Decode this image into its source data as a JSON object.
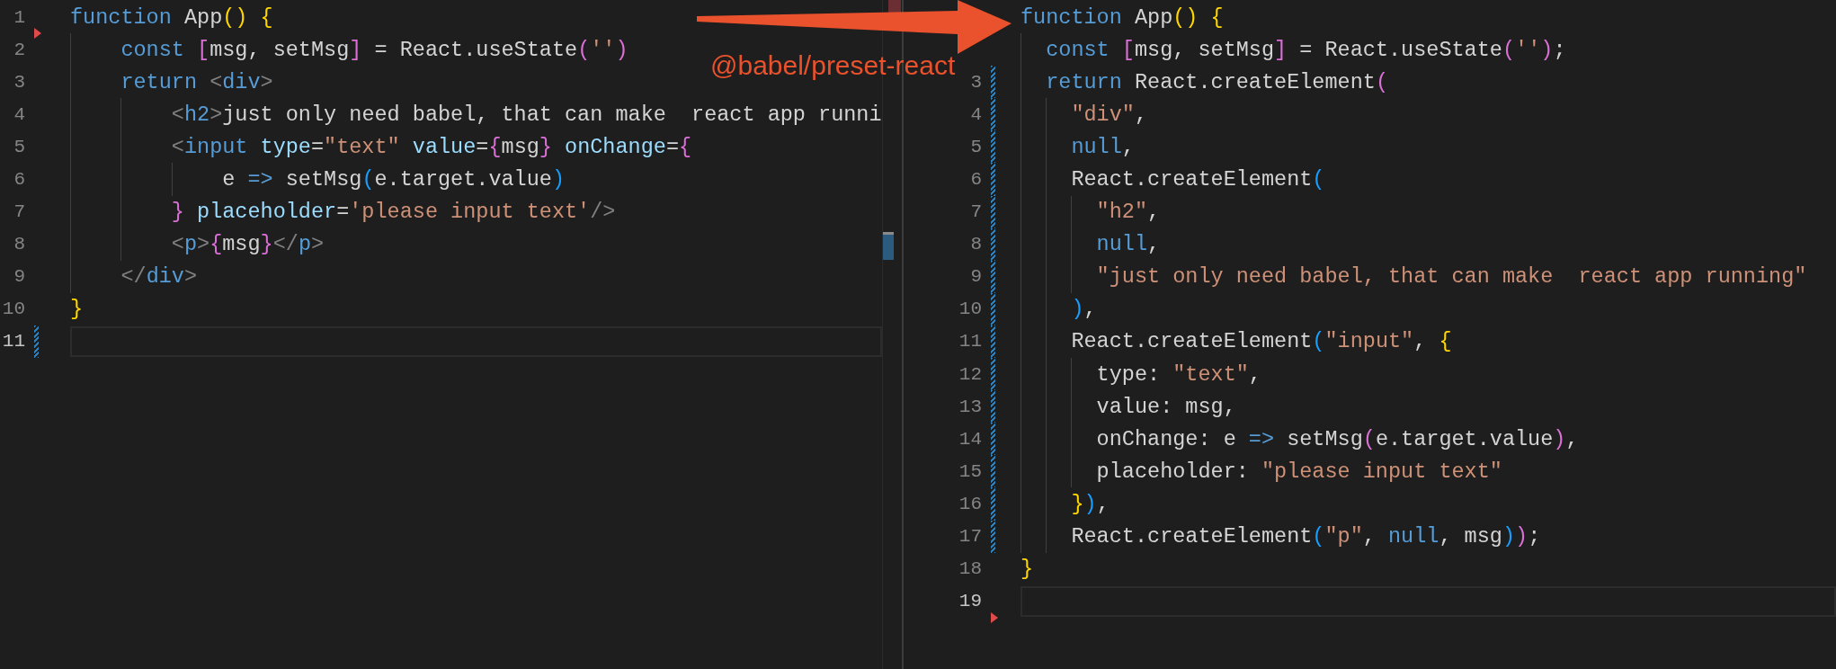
{
  "panes": [
    {
      "lines": [
        {
          "number": "1",
          "current": false,
          "added": false,
          "deleted": true,
          "tokens": [
            {
              "kind": "kw",
              "text": "function"
            },
            {
              "kind": "pl",
              "text": " App"
            },
            {
              "kind": "b1",
              "text": "()"
            },
            {
              "kind": "b1",
              "text": " {"
            }
          ]
        },
        {
          "number": "2",
          "current": false,
          "added": false,
          "deleted": false,
          "tokens": [
            {
              "kind": "kw",
              "text": "    const"
            },
            {
              "kind": "b2",
              "text": " ["
            },
            {
              "kind": "pl",
              "text": "msg, setMsg"
            },
            {
              "kind": "b2",
              "text": "]"
            },
            {
              "kind": "pl",
              "text": " = React.useState"
            },
            {
              "kind": "b2",
              "text": "("
            },
            {
              "kind": "str",
              "text": "''"
            },
            {
              "kind": "b2",
              "text": ")"
            }
          ]
        },
        {
          "number": "3",
          "current": false,
          "added": false,
          "deleted": false,
          "tokens": [
            {
              "kind": "kw",
              "text": "    return"
            },
            {
              "kind": "pu",
              "text": " <"
            },
            {
              "kind": "tag",
              "text": "div"
            },
            {
              "kind": "pu",
              "text": ">"
            }
          ]
        },
        {
          "number": "4",
          "current": false,
          "added": false,
          "deleted": false,
          "tokens": [
            {
              "kind": "pu",
              "text": "        <"
            },
            {
              "kind": "tag",
              "text": "h2"
            },
            {
              "kind": "pu",
              "text": ">"
            },
            {
              "kind": "pl",
              "text": "just only need babel, that can make  react app runni"
            }
          ]
        },
        {
          "number": "5",
          "current": false,
          "added": false,
          "deleted": false,
          "tokens": [
            {
              "kind": "pu",
              "text": "        <"
            },
            {
              "kind": "tag",
              "text": "input"
            },
            {
              "kind": "attr",
              "text": " type"
            },
            {
              "kind": "pl",
              "text": "="
            },
            {
              "kind": "str",
              "text": "\"text\""
            },
            {
              "kind": "attr",
              "text": " value"
            },
            {
              "kind": "pl",
              "text": "="
            },
            {
              "kind": "b2",
              "text": "{"
            },
            {
              "kind": "pl",
              "text": "msg"
            },
            {
              "kind": "b2",
              "text": "}"
            },
            {
              "kind": "attr",
              "text": " onChange"
            },
            {
              "kind": "pl",
              "text": "="
            },
            {
              "kind": "b2",
              "text": "{"
            }
          ]
        },
        {
          "number": "6",
          "current": false,
          "added": false,
          "deleted": false,
          "tokens": [
            {
              "kind": "pl",
              "text": "            e "
            },
            {
              "kind": "kw",
              "text": "=>"
            },
            {
              "kind": "pl",
              "text": " setMsg"
            },
            {
              "kind": "b3",
              "text": "("
            },
            {
              "kind": "pl",
              "text": "e.target.value"
            },
            {
              "kind": "b3",
              "text": ")"
            }
          ]
        },
        {
          "number": "7",
          "current": false,
          "added": false,
          "deleted": false,
          "tokens": [
            {
              "kind": "b2",
              "text": "        }"
            },
            {
              "kind": "attr",
              "text": " placeholder"
            },
            {
              "kind": "pl",
              "text": "="
            },
            {
              "kind": "str",
              "text": "'please input text'"
            },
            {
              "kind": "pu",
              "text": "/>"
            }
          ]
        },
        {
          "number": "8",
          "current": false,
          "added": false,
          "deleted": false,
          "tokens": [
            {
              "kind": "pu",
              "text": "        <"
            },
            {
              "kind": "tag",
              "text": "p"
            },
            {
              "kind": "pu",
              "text": ">"
            },
            {
              "kind": "b2",
              "text": "{"
            },
            {
              "kind": "pl",
              "text": "msg"
            },
            {
              "kind": "b2",
              "text": "}"
            },
            {
              "kind": "pu",
              "text": "</"
            },
            {
              "kind": "tag",
              "text": "p"
            },
            {
              "kind": "pu",
              "text": ">"
            }
          ]
        },
        {
          "number": "9",
          "current": false,
          "added": false,
          "deleted": false,
          "tokens": [
            {
              "kind": "pu",
              "text": "    </"
            },
            {
              "kind": "tag",
              "text": "div"
            },
            {
              "kind": "pu",
              "text": ">"
            }
          ]
        },
        {
          "number": "10",
          "current": false,
          "added": false,
          "deleted": false,
          "tokens": [
            {
              "kind": "b1",
              "text": "}"
            }
          ]
        },
        {
          "number": "11",
          "current": true,
          "added": true,
          "deleted": false
        }
      ]
    },
    {
      "lines": [
        {
          "current": false,
          "added": false,
          "deleted": false,
          "tokens": [
            {
              "kind": "kw",
              "text": "function"
            },
            {
              "kind": "pl",
              "text": " App"
            },
            {
              "kind": "b1",
              "text": "()"
            },
            {
              "kind": "b1",
              "text": " {"
            }
          ]
        },
        {
          "current": false,
          "added": false,
          "deleted": false,
          "tokens": [
            {
              "kind": "kw",
              "text": "  const"
            },
            {
              "kind": "b2",
              "text": " ["
            },
            {
              "kind": "pl",
              "text": "msg, setMsg"
            },
            {
              "kind": "b2",
              "text": "]"
            },
            {
              "kind": "pl",
              "text": " = React.useState"
            },
            {
              "kind": "b2",
              "text": "("
            },
            {
              "kind": "str",
              "text": "''"
            },
            {
              "kind": "b2",
              "text": ")"
            },
            {
              "kind": "pl",
              "text": ";"
            }
          ]
        },
        {
          "number": "3",
          "current": false,
          "added": true,
          "deleted": false,
          "tokens": [
            {
              "kind": "kw",
              "text": "  return"
            },
            {
              "kind": "pl",
              "text": " React.createElement"
            },
            {
              "kind": "b2",
              "text": "("
            }
          ]
        },
        {
          "number": "4",
          "current": false,
          "added": true,
          "deleted": false,
          "tokens": [
            {
              "kind": "str",
              "text": "    \"div\""
            },
            {
              "kind": "pl",
              "text": ","
            }
          ]
        },
        {
          "number": "5",
          "current": false,
          "added": true,
          "deleted": false,
          "tokens": [
            {
              "kind": "kw",
              "text": "    null"
            },
            {
              "kind": "pl",
              "text": ","
            }
          ]
        },
        {
          "number": "6",
          "current": false,
          "added": true,
          "deleted": false,
          "tokens": [
            {
              "kind": "pl",
              "text": "    React.createElement"
            },
            {
              "kind": "b3",
              "text": "("
            }
          ]
        },
        {
          "number": "7",
          "current": false,
          "added": true,
          "deleted": false,
          "tokens": [
            {
              "kind": "str",
              "text": "      \"h2\""
            },
            {
              "kind": "pl",
              "text": ","
            }
          ]
        },
        {
          "number": "8",
          "current": false,
          "added": true,
          "deleted": false,
          "tokens": [
            {
              "kind": "kw",
              "text": "      null"
            },
            {
              "kind": "pl",
              "text": ","
            }
          ]
        },
        {
          "number": "9",
          "current": false,
          "added": true,
          "deleted": false,
          "tokens": [
            {
              "kind": "str",
              "text": "      \"just only need babel, that can make  react app running\""
            }
          ]
        },
        {
          "number": "10",
          "current": false,
          "added": true,
          "deleted": false,
          "tokens": [
            {
              "kind": "b3",
              "text": "    )"
            },
            {
              "kind": "pl",
              "text": ","
            }
          ]
        },
        {
          "number": "11",
          "current": false,
          "added": true,
          "deleted": false,
          "tokens": [
            {
              "kind": "pl",
              "text": "    React.createElement"
            },
            {
              "kind": "b3",
              "text": "("
            },
            {
              "kind": "str",
              "text": "\"input\""
            },
            {
              "kind": "pl",
              "text": ","
            },
            {
              "kind": "b1",
              "text": " {"
            }
          ]
        },
        {
          "number": "12",
          "current": false,
          "added": true,
          "deleted": false,
          "tokens": [
            {
              "kind": "pl",
              "text": "      type:"
            },
            {
              "kind": "str",
              "text": " \"text\""
            },
            {
              "kind": "pl",
              "text": ","
            }
          ]
        },
        {
          "number": "13",
          "current": false,
          "added": true,
          "deleted": false,
          "tokens": [
            {
              "kind": "pl",
              "text": "      value: msg,"
            }
          ]
        },
        {
          "number": "14",
          "current": false,
          "added": true,
          "deleted": false,
          "tokens": [
            {
              "kind": "pl",
              "text": "      onChange: e"
            },
            {
              "kind": "kw",
              "text": " =>"
            },
            {
              "kind": "pl",
              "text": " setMsg"
            },
            {
              "kind": "b2",
              "text": "("
            },
            {
              "kind": "pl",
              "text": "e.target.value"
            },
            {
              "kind": "b2",
              "text": ")"
            },
            {
              "kind": "pl",
              "text": ","
            }
          ]
        },
        {
          "number": "15",
          "current": false,
          "added": true,
          "deleted": false,
          "tokens": [
            {
              "kind": "pl",
              "text": "      placeholder:"
            },
            {
              "kind": "str",
              "text": " \"please input text\""
            }
          ]
        },
        {
          "number": "16",
          "current": false,
          "added": true,
          "deleted": false,
          "tokens": [
            {
              "kind": "b1",
              "text": "    }"
            },
            {
              "kind": "b3",
              "text": ")"
            },
            {
              "kind": "pl",
              "text": ","
            }
          ]
        },
        {
          "number": "17",
          "current": false,
          "added": true,
          "deleted": false,
          "tokens": [
            {
              "kind": "pl",
              "text": "    React.createElement"
            },
            {
              "kind": "b3",
              "text": "("
            },
            {
              "kind": "str",
              "text": "\"p\""
            },
            {
              "kind": "pl",
              "text": ","
            },
            {
              "kind": "kw",
              "text": " null"
            },
            {
              "kind": "pl",
              "text": ", msg"
            },
            {
              "kind": "b3",
              "text": ")"
            },
            {
              "kind": "b2",
              "text": ")"
            },
            {
              "kind": "pl",
              "text": ";"
            }
          ]
        },
        {
          "number": "18",
          "current": false,
          "added": false,
          "deleted": false,
          "tokens": [
            {
              "kind": "b1",
              "text": "}"
            }
          ]
        },
        {
          "number": "19",
          "current": true,
          "added": false,
          "deleted": true
        }
      ]
    }
  ],
  "annotation": {
    "label": "@babel/preset-react"
  }
}
